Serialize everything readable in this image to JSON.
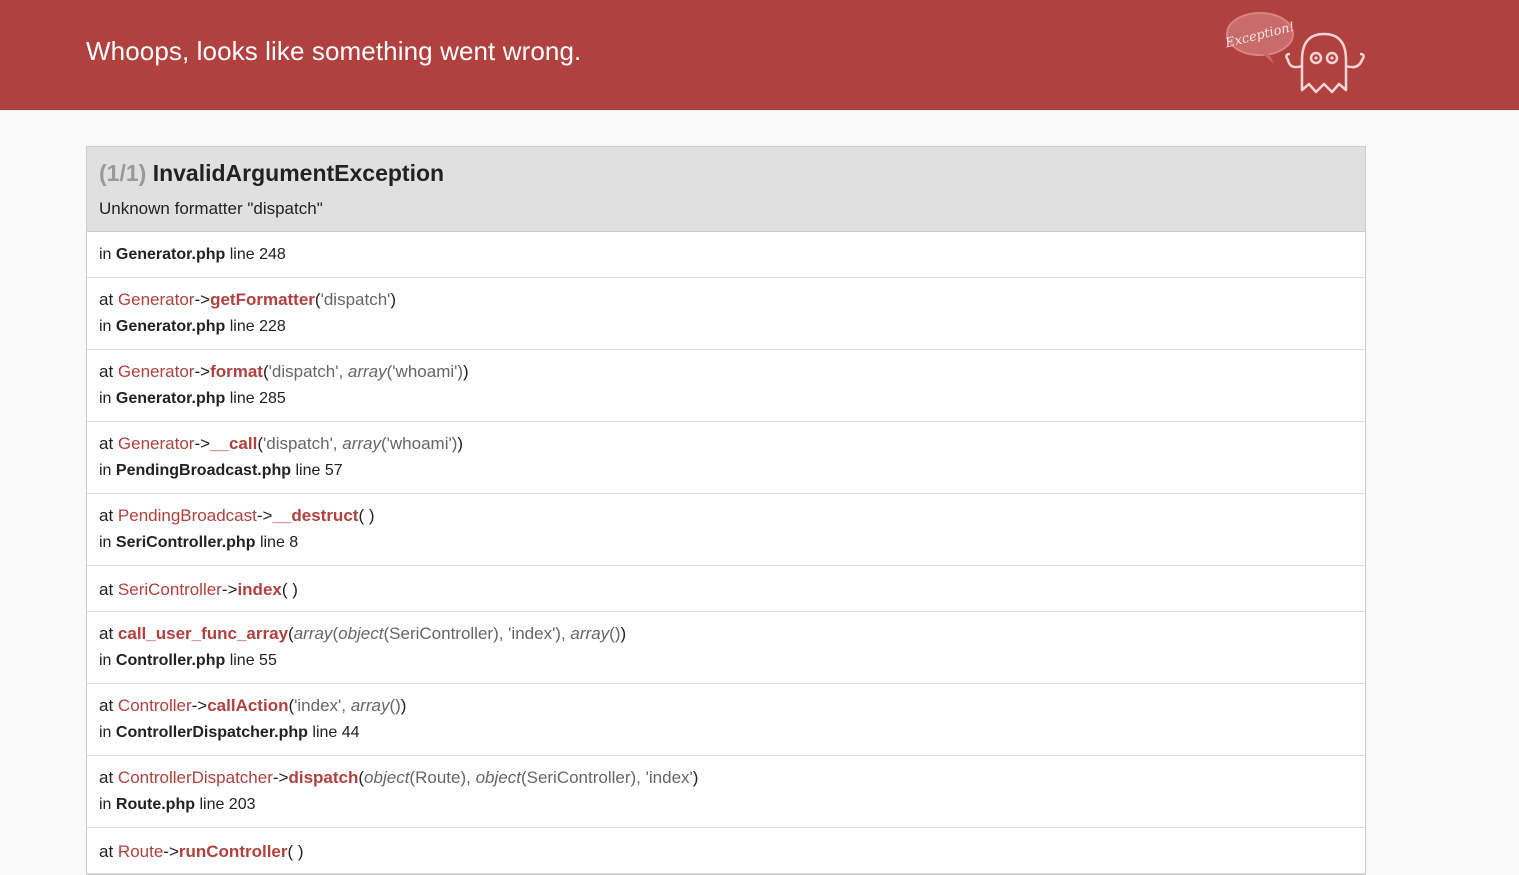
{
  "header": {
    "title": "Whoops, looks like something went wrong.",
    "logo_text": "Exception!"
  },
  "exception": {
    "counter": "(1/1)",
    "class_name": "InvalidArgumentException",
    "message": "Unknown formatter \"dispatch\"",
    "location": {
      "prefix": "in",
      "file": "Generator.php",
      "line_label": "line 248"
    }
  },
  "trace": [
    {
      "at": "at",
      "class": "Generator",
      "arrow": "->",
      "function": "getFormatter",
      "args_open": "(",
      "args": [
        {
          "t": "arg",
          "v": "'dispatch'"
        }
      ],
      "args_close": ")",
      "in": "in",
      "file": "Generator.php",
      "line_label": "line 228"
    },
    {
      "at": "at",
      "class": "Generator",
      "arrow": "->",
      "function": "format",
      "args_open": "(",
      "args": [
        {
          "t": "arg",
          "v": "'dispatch', "
        },
        {
          "t": "type",
          "v": "array"
        },
        {
          "t": "arg",
          "v": "('whoami')"
        }
      ],
      "args_close": ")",
      "in": "in",
      "file": "Generator.php",
      "line_label": "line 285"
    },
    {
      "at": "at",
      "class": "Generator",
      "arrow": "->",
      "function": "__call",
      "args_open": "(",
      "args": [
        {
          "t": "arg",
          "v": "'dispatch', "
        },
        {
          "t": "type",
          "v": "array"
        },
        {
          "t": "arg",
          "v": "('whoami')"
        }
      ],
      "args_close": ")",
      "in": "in",
      "file": "PendingBroadcast.php",
      "line_label": "line 57"
    },
    {
      "at": "at",
      "class": "PendingBroadcast",
      "arrow": "->",
      "function": "__destruct",
      "args_open": "(",
      "args": [],
      "args_close": ")",
      "in": "in",
      "file": "SeriController.php",
      "line_label": "line 8"
    },
    {
      "at": "at",
      "class": "SeriController",
      "arrow": "->",
      "function": "index",
      "args_open": "(",
      "args": [],
      "args_close": ")"
    },
    {
      "at": "at",
      "class": "",
      "arrow": "",
      "function": "call_user_func_array",
      "args_open": "(",
      "args": [
        {
          "t": "type",
          "v": "array"
        },
        {
          "t": "arg",
          "v": "("
        },
        {
          "t": "type",
          "v": "object"
        },
        {
          "t": "arg",
          "v": "(SeriController), 'index'), "
        },
        {
          "t": "type",
          "v": "array"
        },
        {
          "t": "arg",
          "v": "()"
        }
      ],
      "args_close": ")",
      "in": "in",
      "file": "Controller.php",
      "line_label": "line 55"
    },
    {
      "at": "at",
      "class": "Controller",
      "arrow": "->",
      "function": "callAction",
      "args_open": "(",
      "args": [
        {
          "t": "arg",
          "v": "'index', "
        },
        {
          "t": "type",
          "v": "array"
        },
        {
          "t": "arg",
          "v": "()"
        }
      ],
      "args_close": ")",
      "in": "in",
      "file": "ControllerDispatcher.php",
      "line_label": "line 44"
    },
    {
      "at": "at",
      "class": "ControllerDispatcher",
      "arrow": "->",
      "function": "dispatch",
      "args_open": "(",
      "args": [
        {
          "t": "type",
          "v": "object"
        },
        {
          "t": "arg",
          "v": "(Route), "
        },
        {
          "t": "type",
          "v": "object"
        },
        {
          "t": "arg",
          "v": "(SeriController), 'index'"
        }
      ],
      "args_close": ")",
      "in": "in",
      "file": "Route.php",
      "line_label": "line 203"
    },
    {
      "at": "at",
      "class": "Route",
      "arrow": "->",
      "function": "runController",
      "args_open": "(",
      "args": [],
      "args_close": ")"
    }
  ],
  "colors": {
    "header_bg": "#b0413e",
    "accent": "#b0413e",
    "panel_head_bg": "#e0e0e0"
  }
}
